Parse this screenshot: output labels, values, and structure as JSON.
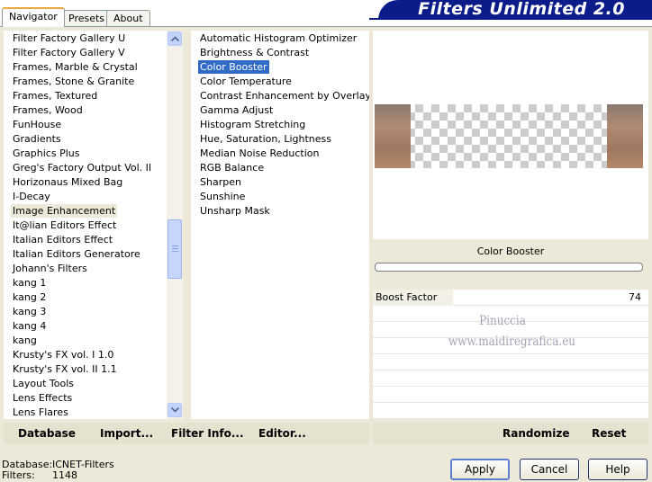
{
  "tabs": [
    {
      "label": "Navigator",
      "active": true
    },
    {
      "label": "Presets",
      "active": false
    },
    {
      "label": "About",
      "active": false
    }
  ],
  "brand_title": "Filters Unlimited 2.0",
  "categories": [
    "Filter Factory Gallery U",
    "Filter Factory Gallery V",
    "Frames, Marble & Crystal",
    "Frames, Stone & Granite",
    "Frames, Textured",
    "Frames, Wood",
    "FunHouse",
    "Gradients",
    "Graphics Plus",
    "Greg's Factory Output Vol. II",
    "Horizonaus Mixed Bag",
    "I-Decay",
    "Image Enhancement",
    "It@lian Editors Effect",
    "Italian Editors Effect",
    "Italian Editors Generatore",
    "Johann's Filters",
    "kang 1",
    "kang 2",
    "kang 3",
    "kang 4",
    "kang",
    "Krusty's FX vol. I 1.0",
    "Krusty's FX vol. II 1.1",
    "Layout Tools",
    "Lens Effects",
    "Lens Flares"
  ],
  "selected_category": "Image Enhancement",
  "filters": [
    "Automatic Histogram Optimizer",
    "Brightness & Contrast",
    "Color Booster",
    "Color Temperature",
    "Contrast Enhancement by Overlay",
    "Gamma Adjust",
    "Histogram Stretching",
    "Hue, Saturation, Lightness",
    "Median Noise Reduction",
    "RGB Balance",
    "Sharpen",
    "Sunshine",
    "Unsharp Mask"
  ],
  "selected_filter": "Color Booster",
  "current_filter_title": "Color Booster",
  "parameters": [
    {
      "label": "Boost Factor",
      "value": "74",
      "fraction": 0.29
    }
  ],
  "watermark": [
    "Pinuccia",
    "www.maidiregrafica.eu"
  ],
  "links": {
    "database": "Database",
    "import": "Import...",
    "filter_info": "Filter Info...",
    "editor": "Editor...",
    "randomize": "Randomize",
    "reset": "Reset"
  },
  "status": {
    "database_label": "Database:",
    "database_value": "ICNET-Filters",
    "filters_label": "Filters:",
    "filters_value": "1148"
  },
  "buttons": {
    "apply": "Apply",
    "cancel": "Cancel",
    "help": "Help"
  },
  "colors": {
    "selection": "#316ac5",
    "brand_bar": "#0c1b8a",
    "dialog_bg": "#ece9d8"
  },
  "scrollbar": {
    "position_fraction": 0.5
  }
}
